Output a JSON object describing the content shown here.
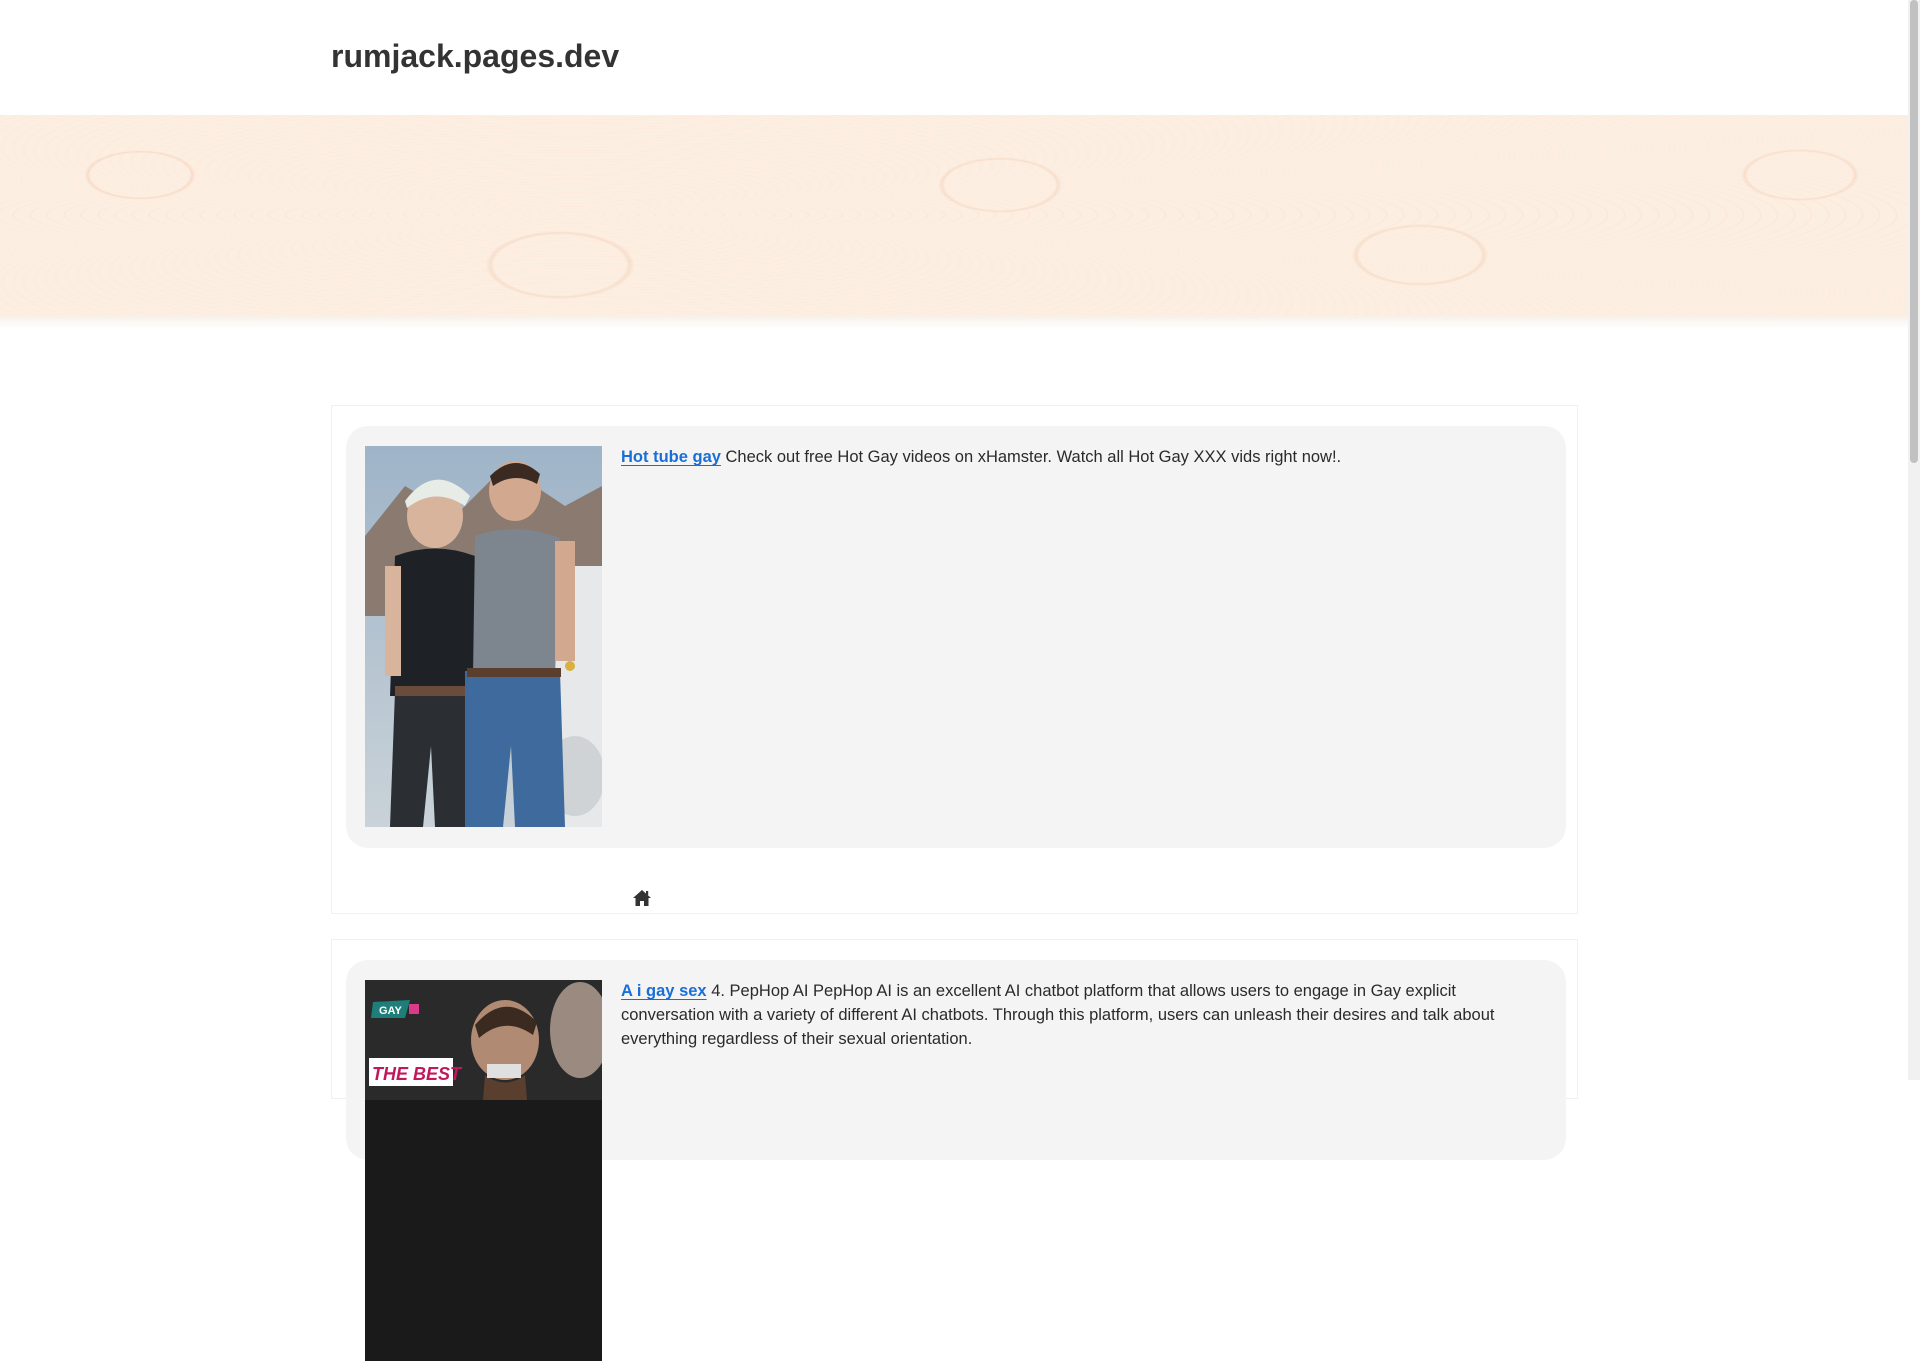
{
  "site": {
    "title": "rumjack.pages.dev"
  },
  "entries": [
    {
      "link_text": "Hot tube gay",
      "description": " Check out free Hot Gay videos on xHamster. Watch all Hot Gay XXX vids right now!.",
      "image_icon": "photo-thumbnail"
    },
    {
      "link_text": "A i gay sex",
      "description": " 4. PepHop AI PepHop AI is an excellent AI chatbot platform that allows users to engage in Gay explicit conversation with a variety of different AI chatbots. Through this platform, users can unleash their desires and talk about everything regardless of their sexual orientation.",
      "image_icon": "photo-thumbnail",
      "image_text": {
        "badge": "GAY",
        "headline": "THE BEST"
      }
    }
  ],
  "icons": {
    "home": "home-icon"
  },
  "colors": {
    "link": "#1a6fd6",
    "banner": "#fdeee2",
    "card": "#f4f4f4"
  }
}
